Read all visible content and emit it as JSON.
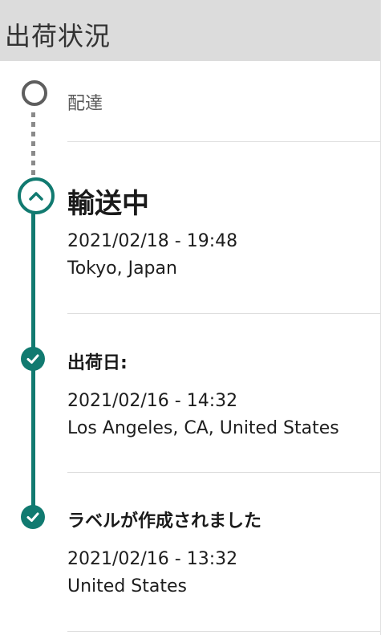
{
  "header": {
    "title": "出荷状況"
  },
  "timeline": {
    "pending": {
      "label": "配達",
      "icon": "circle-outline-icon"
    },
    "current": {
      "title": "輸送中",
      "datetime": "2021/02/18 - 19:48",
      "location": "Tokyo, Japan",
      "icon": "chevron-up-icon"
    },
    "events": [
      {
        "title": "出荷日:",
        "datetime": "2021/02/16 - 14:32",
        "location": "Los Angeles, CA, United States",
        "icon": "check-circle-icon"
      },
      {
        "title": "ラベルが作成されました",
        "datetime": "2021/02/16 - 13:32",
        "location": "United States",
        "icon": "check-circle-icon"
      }
    ]
  },
  "colors": {
    "accent": "#117a70",
    "header_bg": "#dcdcdc",
    "pending": "#5e5e5e"
  }
}
